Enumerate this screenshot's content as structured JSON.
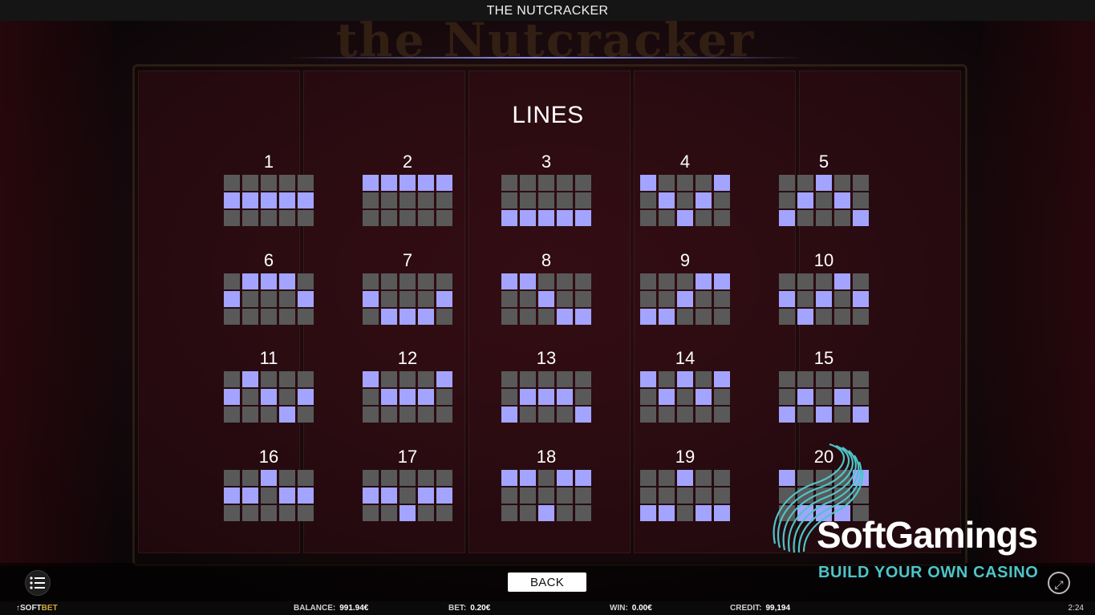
{
  "window": {
    "title": "THE NUTCRACKER"
  },
  "panel": {
    "heading": "LINES"
  },
  "paylines": [
    {
      "number": "1",
      "pattern": [
        [
          0,
          0,
          0,
          0,
          0
        ],
        [
          1,
          1,
          1,
          1,
          1
        ],
        [
          0,
          0,
          0,
          0,
          0
        ]
      ]
    },
    {
      "number": "2",
      "pattern": [
        [
          1,
          1,
          1,
          1,
          1
        ],
        [
          0,
          0,
          0,
          0,
          0
        ],
        [
          0,
          0,
          0,
          0,
          0
        ]
      ]
    },
    {
      "number": "3",
      "pattern": [
        [
          0,
          0,
          0,
          0,
          0
        ],
        [
          0,
          0,
          0,
          0,
          0
        ],
        [
          1,
          1,
          1,
          1,
          1
        ]
      ]
    },
    {
      "number": "4",
      "pattern": [
        [
          1,
          0,
          0,
          0,
          1
        ],
        [
          0,
          1,
          0,
          1,
          0
        ],
        [
          0,
          0,
          1,
          0,
          0
        ]
      ]
    },
    {
      "number": "5",
      "pattern": [
        [
          0,
          0,
          1,
          0,
          0
        ],
        [
          0,
          1,
          0,
          1,
          0
        ],
        [
          1,
          0,
          0,
          0,
          1
        ]
      ]
    },
    {
      "number": "6",
      "pattern": [
        [
          0,
          1,
          1,
          1,
          0
        ],
        [
          1,
          0,
          0,
          0,
          1
        ],
        [
          0,
          0,
          0,
          0,
          0
        ]
      ]
    },
    {
      "number": "7",
      "pattern": [
        [
          0,
          0,
          0,
          0,
          0
        ],
        [
          1,
          0,
          0,
          0,
          1
        ],
        [
          0,
          1,
          1,
          1,
          0
        ]
      ]
    },
    {
      "number": "8",
      "pattern": [
        [
          1,
          1,
          0,
          0,
          0
        ],
        [
          0,
          0,
          1,
          0,
          0
        ],
        [
          0,
          0,
          0,
          1,
          1
        ]
      ]
    },
    {
      "number": "9",
      "pattern": [
        [
          0,
          0,
          0,
          1,
          1
        ],
        [
          0,
          0,
          1,
          0,
          0
        ],
        [
          1,
          1,
          0,
          0,
          0
        ]
      ]
    },
    {
      "number": "10",
      "pattern": [
        [
          0,
          0,
          0,
          1,
          0
        ],
        [
          1,
          0,
          1,
          0,
          1
        ],
        [
          0,
          1,
          0,
          0,
          0
        ]
      ]
    },
    {
      "number": "11",
      "pattern": [
        [
          0,
          1,
          0,
          0,
          0
        ],
        [
          1,
          0,
          1,
          0,
          1
        ],
        [
          0,
          0,
          0,
          1,
          0
        ]
      ]
    },
    {
      "number": "12",
      "pattern": [
        [
          1,
          0,
          0,
          0,
          1
        ],
        [
          0,
          1,
          1,
          1,
          0
        ],
        [
          0,
          0,
          0,
          0,
          0
        ]
      ]
    },
    {
      "number": "13",
      "pattern": [
        [
          0,
          0,
          0,
          0,
          0
        ],
        [
          0,
          1,
          1,
          1,
          0
        ],
        [
          1,
          0,
          0,
          0,
          1
        ]
      ]
    },
    {
      "number": "14",
      "pattern": [
        [
          1,
          0,
          1,
          0,
          1
        ],
        [
          0,
          1,
          0,
          1,
          0
        ],
        [
          0,
          0,
          0,
          0,
          0
        ]
      ]
    },
    {
      "number": "15",
      "pattern": [
        [
          0,
          0,
          0,
          0,
          0
        ],
        [
          0,
          1,
          0,
          1,
          0
        ],
        [
          1,
          0,
          1,
          0,
          1
        ]
      ]
    },
    {
      "number": "16",
      "pattern": [
        [
          0,
          0,
          1,
          0,
          0
        ],
        [
          1,
          1,
          0,
          1,
          1
        ],
        [
          0,
          0,
          0,
          0,
          0
        ]
      ]
    },
    {
      "number": "17",
      "pattern": [
        [
          0,
          0,
          0,
          0,
          0
        ],
        [
          1,
          1,
          0,
          1,
          1
        ],
        [
          0,
          0,
          1,
          0,
          0
        ]
      ]
    },
    {
      "number": "18",
      "pattern": [
        [
          1,
          1,
          0,
          1,
          1
        ],
        [
          0,
          0,
          0,
          0,
          0
        ],
        [
          0,
          0,
          1,
          0,
          0
        ]
      ]
    },
    {
      "number": "19",
      "pattern": [
        [
          0,
          0,
          1,
          0,
          0
        ],
        [
          0,
          0,
          0,
          0,
          0
        ],
        [
          1,
          1,
          0,
          1,
          1
        ]
      ]
    },
    {
      "number": "20",
      "pattern": [
        [
          1,
          0,
          0,
          0,
          1
        ],
        [
          0,
          0,
          0,
          0,
          0
        ],
        [
          0,
          1,
          1,
          1,
          0
        ]
      ]
    }
  ],
  "controls": {
    "back_label": "BACK",
    "menu_icon": "menu-list-icon",
    "expand_icon": "expand-icon"
  },
  "status": {
    "brand_prefix": "↑SOFT",
    "brand_suffix": "BET",
    "balance_label": "BALANCE:",
    "balance_value": "991.94€",
    "bet_label": "BET:",
    "bet_value": "0.20€",
    "win_label": "WIN:",
    "win_value": "0.00€",
    "credit_label": "CREDIT:",
    "credit_value": "99,194",
    "clock": "2:24"
  },
  "watermark": {
    "name": "SoftGamings",
    "tagline": "BUILD YOUR OWN CASINO"
  },
  "colors": {
    "active_cell": "#a3a4ff",
    "inactive_cell": "#595959",
    "accent": "#4ec4c7"
  }
}
